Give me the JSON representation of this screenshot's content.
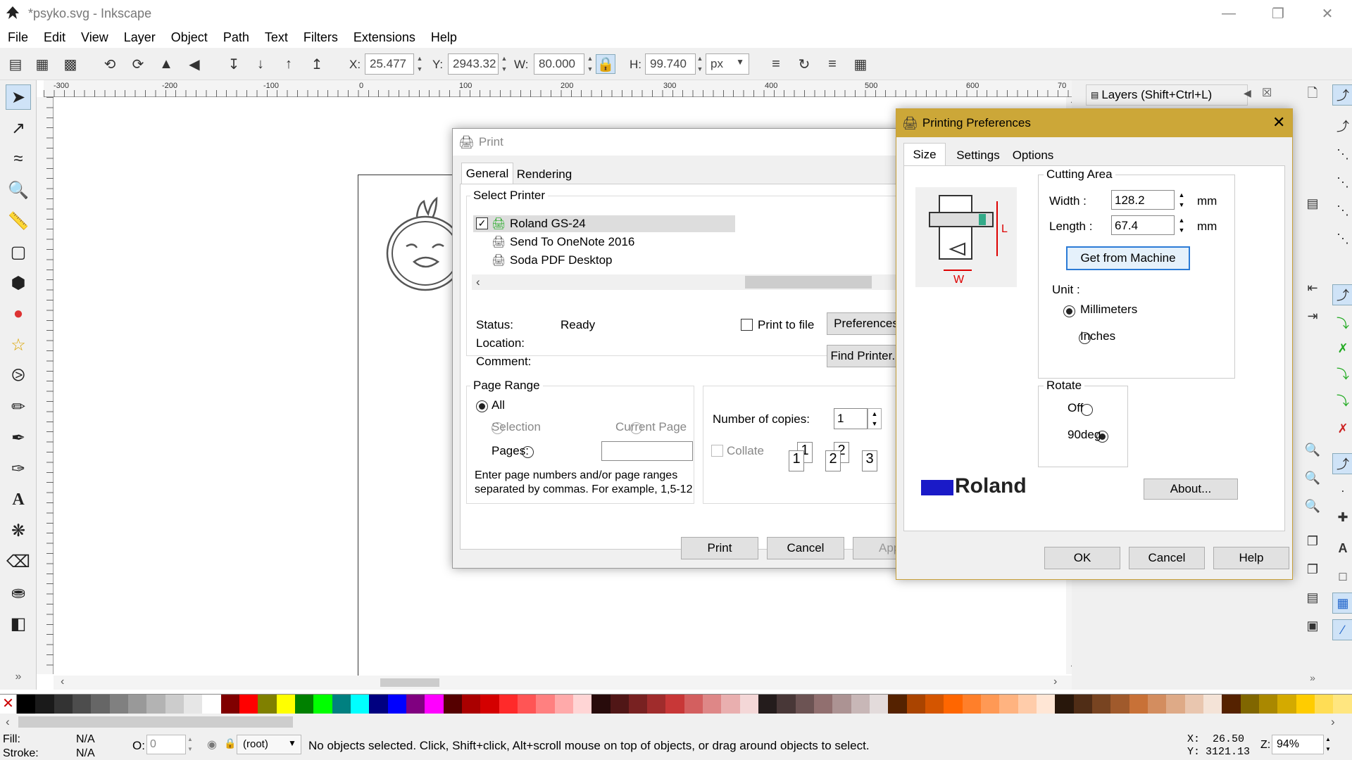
{
  "window": {
    "title": "*psyko.svg - Inkscape"
  },
  "menu": [
    "File",
    "Edit",
    "View",
    "Layer",
    "Object",
    "Path",
    "Text",
    "Filters",
    "Extensions",
    "Help"
  ],
  "toolbar": {
    "x_label": "X:",
    "x_value": "25.477",
    "y_label": "Y:",
    "y_value": "2943.32",
    "w_label": "W:",
    "w_value": "80.000",
    "h_label": "H:",
    "h_value": "99.740",
    "unit": "px"
  },
  "ruler": {
    "h_ticks": [
      "-300",
      "-200",
      "-100",
      "0",
      "100",
      "200",
      "300",
      "400",
      "500",
      "600",
      "70"
    ]
  },
  "layers_panel": {
    "title": "Layers (Shift+Ctrl+L)"
  },
  "print_dialog": {
    "title": "Print",
    "tabs": [
      "General",
      "Rendering"
    ],
    "select_printer_label": "Select Printer",
    "printers": [
      "Roland GS-24",
      "Send To OneNote 2016",
      "Soda PDF Desktop"
    ],
    "status_label": "Status:",
    "status_value": "Ready",
    "location_label": "Location:",
    "comment_label": "Comment:",
    "print_to_file": "Print to file",
    "preferences_btn": "Preferences",
    "find_printer_btn": "Find Printer...",
    "page_range_label": "Page Range",
    "all": "All",
    "selection": "Selection",
    "current_page": "Current Page",
    "pages": "Pages:",
    "hint": "Enter page numbers and/or page ranges separated by commas.  For example, 1,5-12",
    "copies_label": "Number of copies:",
    "copies_value": "1",
    "collate": "Collate",
    "collate_pages": [
      "1",
      "1",
      "2",
      "2",
      "3"
    ],
    "print_btn": "Print",
    "cancel_btn": "Cancel",
    "apply_btn": "App"
  },
  "prefs_dialog": {
    "title": "Printing Preferences",
    "tabs": [
      "Size",
      "Settings",
      "Options"
    ],
    "cutting_area": "Cutting Area",
    "width_label": "Width :",
    "width_value": "128.2",
    "width_unit": "mm",
    "length_label": "Length :",
    "length_value": "67.4",
    "length_unit": "mm",
    "get_from_machine": "Get from Machine",
    "unit_label": "Unit :",
    "millimeters": "Millimeters",
    "inches": "Inches",
    "rotate_label": "Rotate",
    "off": "Off",
    "deg90": "90deg",
    "diagram_l": "L",
    "diagram_w": "W",
    "brand": "Roland",
    "about_btn": "About...",
    "ok_btn": "OK",
    "cancel_btn": "Cancel",
    "help_btn": "Help"
  },
  "statusbar": {
    "fill_label": "Fill:",
    "fill_value": "N/A",
    "stroke_label": "Stroke:",
    "stroke_value": "N/A",
    "opacity_label": "O:",
    "opacity_value": "0",
    "layer": "(root)",
    "message": "No objects selected. Click, Shift+click, Alt+scroll mouse on top of objects, or drag around objects to select.",
    "x_label": "X:",
    "x_value": "26.50",
    "y_label": "Y:",
    "y_value": "3121.13",
    "zoom_label": "Z:",
    "zoom_value": "94%"
  },
  "palette": [
    "#000000",
    "#1a1a1a",
    "#333333",
    "#4d4d4d",
    "#666666",
    "#808080",
    "#999999",
    "#b3b3b3",
    "#cccccc",
    "#e6e6e6",
    "#ffffff",
    "#800000",
    "#ff0000",
    "#808000",
    "#ffff00",
    "#008000",
    "#00ff00",
    "#008080",
    "#00ffff",
    "#000080",
    "#0000ff",
    "#800080",
    "#ff00ff",
    "#550000",
    "#aa0000",
    "#d40000",
    "#ff2a2a",
    "#ff5555",
    "#ff8080",
    "#ffaaaa",
    "#ffd5d5",
    "#280b0b",
    "#501616",
    "#782121",
    "#a02c2c",
    "#c83737",
    "#d35f5f",
    "#de8787",
    "#e9afaf",
    "#f4d7d7",
    "#241c1c",
    "#483737",
    "#6c5353",
    "#916f6f",
    "#ac9393",
    "#c8b7b7",
    "#e3dbdb",
    "#552200",
    "#aa4400",
    "#d45500",
    "#ff6600",
    "#ff7f2a",
    "#ff9955",
    "#ffb380",
    "#ffccaa",
    "#ffe6d5",
    "#28170b",
    "#502d16",
    "#784421",
    "#a05a2c",
    "#c87137",
    "#d38d5f",
    "#deaa87",
    "#e9c6af",
    "#f4e3d7",
    "#552200",
    "#806600",
    "#aa8800",
    "#d4aa00",
    "#ffcc00",
    "#ffdd55",
    "#ffe680"
  ]
}
